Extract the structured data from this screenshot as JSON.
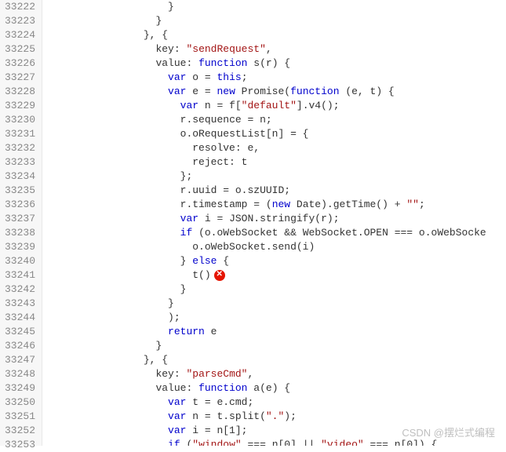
{
  "editor": {
    "lines": [
      {
        "num": "33222",
        "indent": 20,
        "text": "}"
      },
      {
        "num": "33223",
        "indent": 18,
        "text": "}"
      },
      {
        "num": "33224",
        "indent": 16,
        "text": "}, {"
      },
      {
        "num": "33225",
        "indent": 18,
        "segments": [
          {
            "text": "key: ",
            "cls": ""
          },
          {
            "text": "\"sendRequest\"",
            "cls": "str"
          },
          {
            "text": ",",
            "cls": ""
          }
        ]
      },
      {
        "num": "33226",
        "indent": 18,
        "segments": [
          {
            "text": "value: ",
            "cls": ""
          },
          {
            "text": "function",
            "cls": "kw"
          },
          {
            "text": " s(r) {",
            "cls": ""
          }
        ]
      },
      {
        "num": "33227",
        "indent": 20,
        "segments": [
          {
            "text": "var",
            "cls": "kw"
          },
          {
            "text": " o = ",
            "cls": ""
          },
          {
            "text": "this",
            "cls": "kw"
          },
          {
            "text": ";",
            "cls": ""
          }
        ]
      },
      {
        "num": "33228",
        "indent": 20,
        "segments": [
          {
            "text": "var",
            "cls": "kw"
          },
          {
            "text": " e = ",
            "cls": ""
          },
          {
            "text": "new",
            "cls": "kw"
          },
          {
            "text": " Promise(",
            "cls": ""
          },
          {
            "text": "function",
            "cls": "kw"
          },
          {
            "text": " (e, t) {",
            "cls": ""
          }
        ]
      },
      {
        "num": "33229",
        "indent": 22,
        "segments": [
          {
            "text": "var",
            "cls": "kw"
          },
          {
            "text": " n = f[",
            "cls": ""
          },
          {
            "text": "\"default\"",
            "cls": "str"
          },
          {
            "text": "].v4();",
            "cls": ""
          }
        ]
      },
      {
        "num": "33230",
        "indent": 22,
        "text": "r.sequence = n;"
      },
      {
        "num": "33231",
        "indent": 22,
        "text": "o.oRequestList[n] = {"
      },
      {
        "num": "33232",
        "indent": 24,
        "text": "resolve: e,"
      },
      {
        "num": "33233",
        "indent": 24,
        "text": "reject: t"
      },
      {
        "num": "33234",
        "indent": 22,
        "text": "};"
      },
      {
        "num": "33235",
        "indent": 22,
        "text": "r.uuid = o.szUUID;"
      },
      {
        "num": "33236",
        "indent": 22,
        "segments": [
          {
            "text": "r.timestamp = (",
            "cls": ""
          },
          {
            "text": "new",
            "cls": "kw"
          },
          {
            "text": " Date).getTime() + ",
            "cls": ""
          },
          {
            "text": "\"\"",
            "cls": "str"
          },
          {
            "text": ";",
            "cls": ""
          }
        ]
      },
      {
        "num": "33237",
        "indent": 22,
        "segments": [
          {
            "text": "var",
            "cls": "kw"
          },
          {
            "text": " i = JSON.stringify(r);",
            "cls": ""
          }
        ]
      },
      {
        "num": "33238",
        "indent": 22,
        "segments": [
          {
            "text": "if",
            "cls": "kw"
          },
          {
            "text": " (o.oWebSocket && WebSocket.OPEN === o.oWebSocke",
            "cls": ""
          }
        ]
      },
      {
        "num": "33239",
        "indent": 24,
        "text": "o.oWebSocket.send(i)"
      },
      {
        "num": "33240",
        "indent": 22,
        "segments": [
          {
            "text": "} ",
            "cls": ""
          },
          {
            "text": "else",
            "cls": "kw"
          },
          {
            "text": " {",
            "cls": ""
          }
        ]
      },
      {
        "num": "33241",
        "indent": 24,
        "text": "t()",
        "error": true
      },
      {
        "num": "33242",
        "indent": 22,
        "text": "}"
      },
      {
        "num": "33243",
        "indent": 20,
        "text": "}"
      },
      {
        "num": "33244",
        "indent": 20,
        "text": ");"
      },
      {
        "num": "33245",
        "indent": 20,
        "segments": [
          {
            "text": "return",
            "cls": "kw"
          },
          {
            "text": " e",
            "cls": ""
          }
        ]
      },
      {
        "num": "33246",
        "indent": 18,
        "text": "}"
      },
      {
        "num": "33247",
        "indent": 16,
        "text": "}, {"
      },
      {
        "num": "33248",
        "indent": 18,
        "segments": [
          {
            "text": "key: ",
            "cls": ""
          },
          {
            "text": "\"parseCmd\"",
            "cls": "str"
          },
          {
            "text": ",",
            "cls": ""
          }
        ]
      },
      {
        "num": "33249",
        "indent": 18,
        "segments": [
          {
            "text": "value: ",
            "cls": ""
          },
          {
            "text": "function",
            "cls": "kw"
          },
          {
            "text": " a(e) {",
            "cls": ""
          }
        ]
      },
      {
        "num": "33250",
        "indent": 20,
        "segments": [
          {
            "text": "var",
            "cls": "kw"
          },
          {
            "text": " t = e.cmd;",
            "cls": ""
          }
        ]
      },
      {
        "num": "33251",
        "indent": 20,
        "segments": [
          {
            "text": "var",
            "cls": "kw"
          },
          {
            "text": " n = t.split(",
            "cls": ""
          },
          {
            "text": "\".\"",
            "cls": "str"
          },
          {
            "text": ");",
            "cls": ""
          }
        ]
      },
      {
        "num": "33252",
        "indent": 20,
        "segments": [
          {
            "text": "var",
            "cls": "kw"
          },
          {
            "text": " i = n[1];",
            "cls": ""
          }
        ]
      },
      {
        "num": "33253",
        "indent": 20,
        "segments": [
          {
            "text": "if",
            "cls": "kw"
          },
          {
            "text": " (",
            "cls": ""
          },
          {
            "text": "\"window\"",
            "cls": "str"
          },
          {
            "text": " === n[0] || ",
            "cls": ""
          },
          {
            "text": "\"video\"",
            "cls": "str"
          },
          {
            "text": " === n[0]) {",
            "cls": ""
          }
        ]
      }
    ]
  },
  "watermark_text": "CSDN @摆烂式编程"
}
